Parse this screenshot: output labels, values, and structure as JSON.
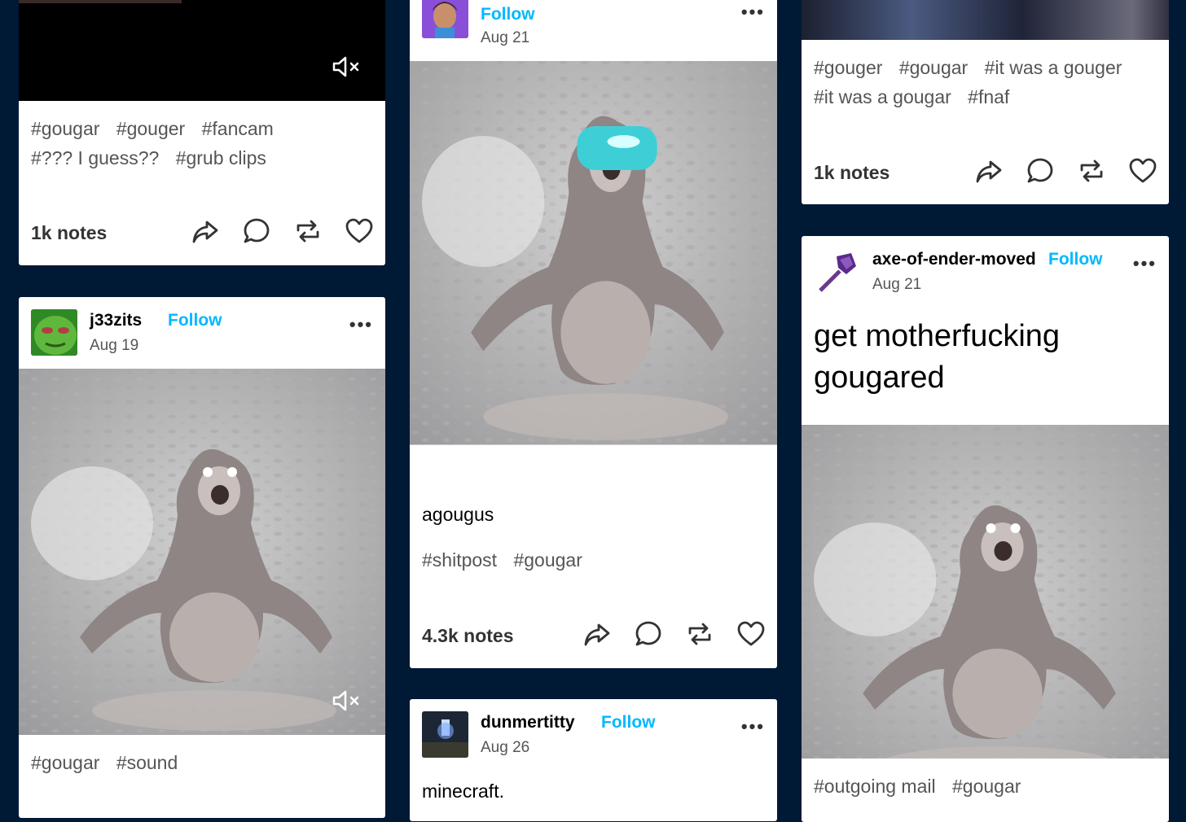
{
  "colors": {
    "background": "#001935",
    "follow": "#00b8ff"
  },
  "col1_top": {
    "tags": [
      "#gougar",
      "#gouger",
      "#fancam",
      "#??? I guess??",
      "#grub clips"
    ],
    "notes": "1k notes",
    "icons": [
      "volume-mute-icon"
    ]
  },
  "col1_post2": {
    "username": "j33zits",
    "follow": "Follow",
    "date": "Aug 19",
    "menu": "•••",
    "tags": [
      "#gougar",
      "#sound"
    ],
    "icons": [
      "volume-mute-icon"
    ]
  },
  "col2_post1": {
    "follow": "Follow",
    "date": "Aug 21",
    "menu": "•••",
    "caption": "agougus",
    "tags": [
      "#shitpost",
      "#gougar"
    ],
    "notes": "4.3k notes"
  },
  "col2_post2": {
    "username": "dunmertitty",
    "follow": "Follow",
    "date": "Aug 26",
    "menu": "•••",
    "text": "minecraft."
  },
  "col3_top": {
    "tags": [
      "#gouger",
      "#gougar",
      "#it was a gouger",
      "#it was a gougar",
      "#fnaf"
    ],
    "notes": "1k notes"
  },
  "col3_post2": {
    "username": "axe-of-ender-moved",
    "follow": "Follow",
    "date": "Aug 21",
    "menu": "•••",
    "text": "get motherfucking gougared",
    "tags": [
      "#outgoing mail",
      "#gougar"
    ]
  },
  "action_icons": [
    "share-icon",
    "reply-icon",
    "reblog-icon",
    "like-icon"
  ]
}
